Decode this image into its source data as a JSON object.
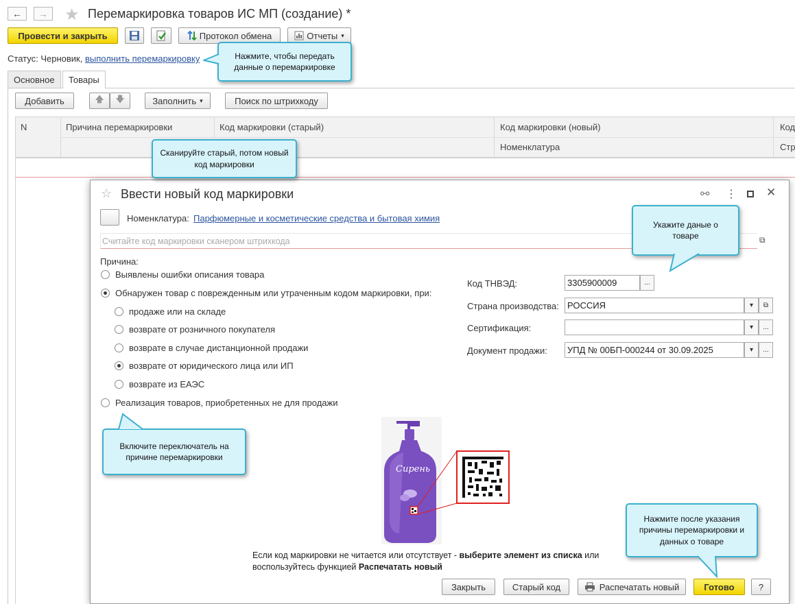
{
  "window": {
    "title": "Перемаркировка товаров ИС МП (создание) *",
    "back_icon": "←",
    "forward_icon": "→",
    "star_icon": "★"
  },
  "toolbar": {
    "post_close": "Провести и закрыть",
    "exchange_log": "Протокол обмена",
    "reports": "Отчеты"
  },
  "status": {
    "label": "Статус:",
    "value": "Черновик,",
    "action_link": "выполнить перемаркировку"
  },
  "tabs": [
    "Основное",
    "Товары"
  ],
  "goods_toolbar": {
    "add": "Добавить",
    "fill": "Заполнить",
    "barcode_search": "Поиск по штрихкоду"
  },
  "table": {
    "col_n": "N",
    "col_reason": "Причина перемаркировки",
    "col_old": "Код маркировки (старый)",
    "col_new": "Код маркировки (новый)",
    "col_nomenclature": "Номенклатура",
    "col_cut_1": "Код",
    "col_cut_2": "Стр"
  },
  "dialog": {
    "title": "Ввести новый код маркировки",
    "nomenclature_label": "Номенклатура:",
    "nomenclature_value": "Парфюмерные и косметические средства и бытовая химия",
    "scan_placeholder": "Считайте код маркировки сканером штрихкода",
    "reason_label": "Причина:",
    "reasons": {
      "description_errors": "Выявлены ошибки описания товара",
      "damaged_code": "Обнаружен товар с поврежденным или утраченным кодом маркировки, при:",
      "sub_sale": "продаже или на складе",
      "sub_retail_return": "возврате от розничного покупателя",
      "sub_remote_return": "возврате в случае дистанционной продажи",
      "sub_legal_return": "возврате от юридического лица или ИП",
      "sub_eaeu": "возврате из ЕАЭС",
      "not_for_sale": "Реализация товаров, приобретенных не для продажи"
    },
    "fields": {
      "tnved_label": "Код ТНВЭД:",
      "tnved_value": "3305900009",
      "country_label": "Страна производства:",
      "country_value": "РОССИЯ",
      "cert_label": "Сертификация:",
      "cert_value": "",
      "sale_doc_label": "Документ продажи:",
      "sale_doc_value": "УПД № 00БП-000244 от 30.09.2025"
    },
    "product_brand": "Сирень",
    "hint_part1": "Если код маркировки не читается или отсутствует - ",
    "hint_bold1": "выберите элемент из списка",
    "hint_part2": " или",
    "hint_part3": "воспользуйтесь функцией ",
    "hint_bold2": "Распечатать новый",
    "buttons": {
      "close": "Закрыть",
      "old_code": "Старый код",
      "print_new": "Распечатать новый",
      "done": "Готово",
      "help": "?"
    }
  },
  "callouts": {
    "status": "Нажмите, чтобы передать данные о перемаркировке",
    "scan": "Сканируйте старый, потом новый код маркировки",
    "product": "Укажите даные о товаре",
    "reason": "Включите переключатель на причине перемаркировки",
    "done": "Нажмите после указания причины перемаркировки и данных о товаре"
  },
  "colors": {
    "accent_yellow": "#f2d400",
    "callout_bg": "#d8f4fb",
    "callout_border": "#3bb0cf",
    "link": "#2b55a0",
    "bottle": "#7a4fc0"
  }
}
